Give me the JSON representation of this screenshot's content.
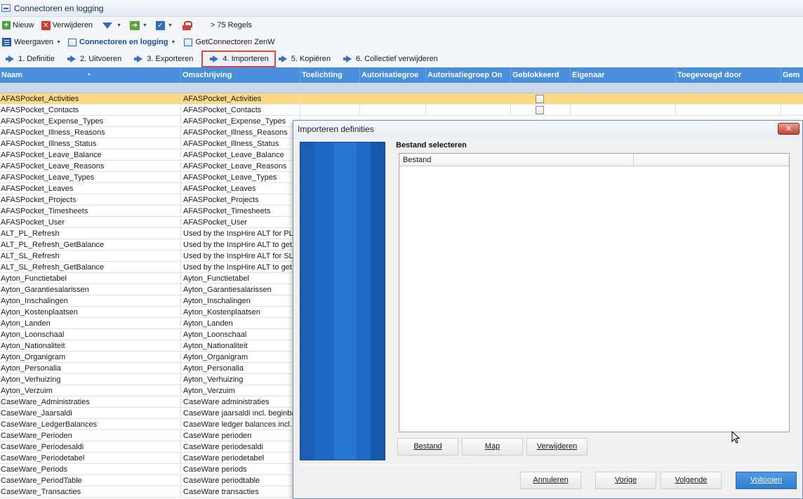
{
  "window": {
    "title": "Connectoren en logging"
  },
  "toolbar1": {
    "new_label": "Nieuw",
    "delete_label": "Verwijderen",
    "rules_label": "> 75 Regels"
  },
  "toolbar2": {
    "views_label": "Weergaven",
    "connectors_label": "Connectoren en logging",
    "getconnector_label": "GetConnectoren ZenW"
  },
  "steps": [
    {
      "label": "1. Definitie"
    },
    {
      "label": "2. Uitvoeren"
    },
    {
      "label": "3. Exporteren"
    },
    {
      "label": "4. Importeren"
    },
    {
      "label": "5. Kopiëren"
    },
    {
      "label": "6. Collectief verwijderen"
    }
  ],
  "grid": {
    "columns": [
      "Naam",
      "Omschrijving",
      "Toelichting",
      "Autorisatiegroe",
      "Autorisatiegroep On",
      "Geblokkeerd",
      "Eigenaar",
      "Toegevoegd door",
      "Gem"
    ],
    "rows": [
      {
        "name": "AFASPocket_Activities",
        "desc": "AFASPocket_Activities",
        "checkbox": true,
        "selected": true
      },
      {
        "name": "AFASPocket_Contacts",
        "desc": "AFASPocket_Contacts",
        "checkbox": true
      },
      {
        "name": "AFASPocket_Expense_Types",
        "desc": "AFASPocket_Expense_Types"
      },
      {
        "name": "AFASPocket_Illness_Reasons",
        "desc": "AFASPocket_Illness_Reasons"
      },
      {
        "name": "AFASPocket_Illness_Status",
        "desc": "AFASPocket_Illness_Status"
      },
      {
        "name": "AFASPocket_Leave_Balance",
        "desc": "AFASPocket_Leave_Balance"
      },
      {
        "name": "AFASPocket_Leave_Reasons",
        "desc": "AFASPocket_Leave_Reasons"
      },
      {
        "name": "AFASPocket_Leave_Types",
        "desc": "AFASPocket_Leave_Types"
      },
      {
        "name": "AFASPocket_Leaves",
        "desc": "AFASPocket_Leaves"
      },
      {
        "name": "AFASPocket_Projects",
        "desc": "AFASPocket_Projects"
      },
      {
        "name": "AFASPocket_Timesheets",
        "desc": "AFASPocket_Timesheets"
      },
      {
        "name": "AFASPocket_User",
        "desc": "AFASPocket_User"
      },
      {
        "name": "ALT_PL_Refresh",
        "desc": "Used by the InspHire ALT for PL"
      },
      {
        "name": "ALT_PL_Refresh_GetBalance",
        "desc": "Used by the InspHire ALT to get"
      },
      {
        "name": "ALT_SL_Refresh",
        "desc": "Used by the InspHire ALT for SL"
      },
      {
        "name": "ALT_SL_Refresh_GetBalance",
        "desc": "Used by the InspHire ALT to get"
      },
      {
        "name": "Ayton_Functietabel",
        "desc": "Ayton_Functietabel"
      },
      {
        "name": "Ayton_Garantiesalarissen",
        "desc": "Ayton_Garantiesalarissen"
      },
      {
        "name": "Ayton_Inschalingen",
        "desc": "Ayton_Inschalingen"
      },
      {
        "name": "Ayton_Kostenplaatsen",
        "desc": "Ayton_Kostenplaatsen"
      },
      {
        "name": "Ayton_Landen",
        "desc": "Ayton_Landen"
      },
      {
        "name": "Ayton_Loonschaal",
        "desc": "Ayton_Loonschaal"
      },
      {
        "name": "Ayton_Nationaliteit",
        "desc": "Ayton_Nationaliteit"
      },
      {
        "name": "Ayton_Organigram",
        "desc": "Ayton_Organigram"
      },
      {
        "name": "Ayton_Personalia",
        "desc": "Ayton_Personalia"
      },
      {
        "name": "Ayton_Verhuizing",
        "desc": "Ayton_Verhuizing"
      },
      {
        "name": "Ayton_Verzuim",
        "desc": "Ayton_Verzuim"
      },
      {
        "name": "CaseWare_Administraties",
        "desc": "CaseWare administraties"
      },
      {
        "name": "CaseWare_Jaarsaldi",
        "desc": "CaseWare jaarsaldi incl. beginbal"
      },
      {
        "name": "CaseWare_LedgerBalances",
        "desc": "CaseWare ledger balances incl. o"
      },
      {
        "name": "CaseWare_Perioden",
        "desc": "CaseWare perioden"
      },
      {
        "name": "CaseWare_Periodesaldi",
        "desc": "CaseWare periodesaldi"
      },
      {
        "name": "CaseWare_Periodetabel",
        "desc": "CaseWare periodetabel"
      },
      {
        "name": "CaseWare_Periods",
        "desc": "CaseWare periods"
      },
      {
        "name": "CaseWare_PeriodTable",
        "desc": "CaseWare periodtable"
      },
      {
        "name": "CaseWare_Transacties",
        "desc": "CaseWare transacties"
      }
    ]
  },
  "dialog": {
    "title": "Importeren definities",
    "close_label": "✕",
    "section_title": "Bestand selecteren",
    "list_header": "Bestand",
    "buttons": {
      "file": "Bestand",
      "map": "Map",
      "remove": "Verwijderen",
      "cancel": "Annuleren",
      "previous": "Vorige",
      "next": "Volgende",
      "finish": "Voltooien"
    }
  },
  "colors": {
    "header_blue": "#4a8fdc",
    "selected_row": "#fcd985",
    "banner_blue": "#1d68c2",
    "highlight_red": "#e04545"
  }
}
